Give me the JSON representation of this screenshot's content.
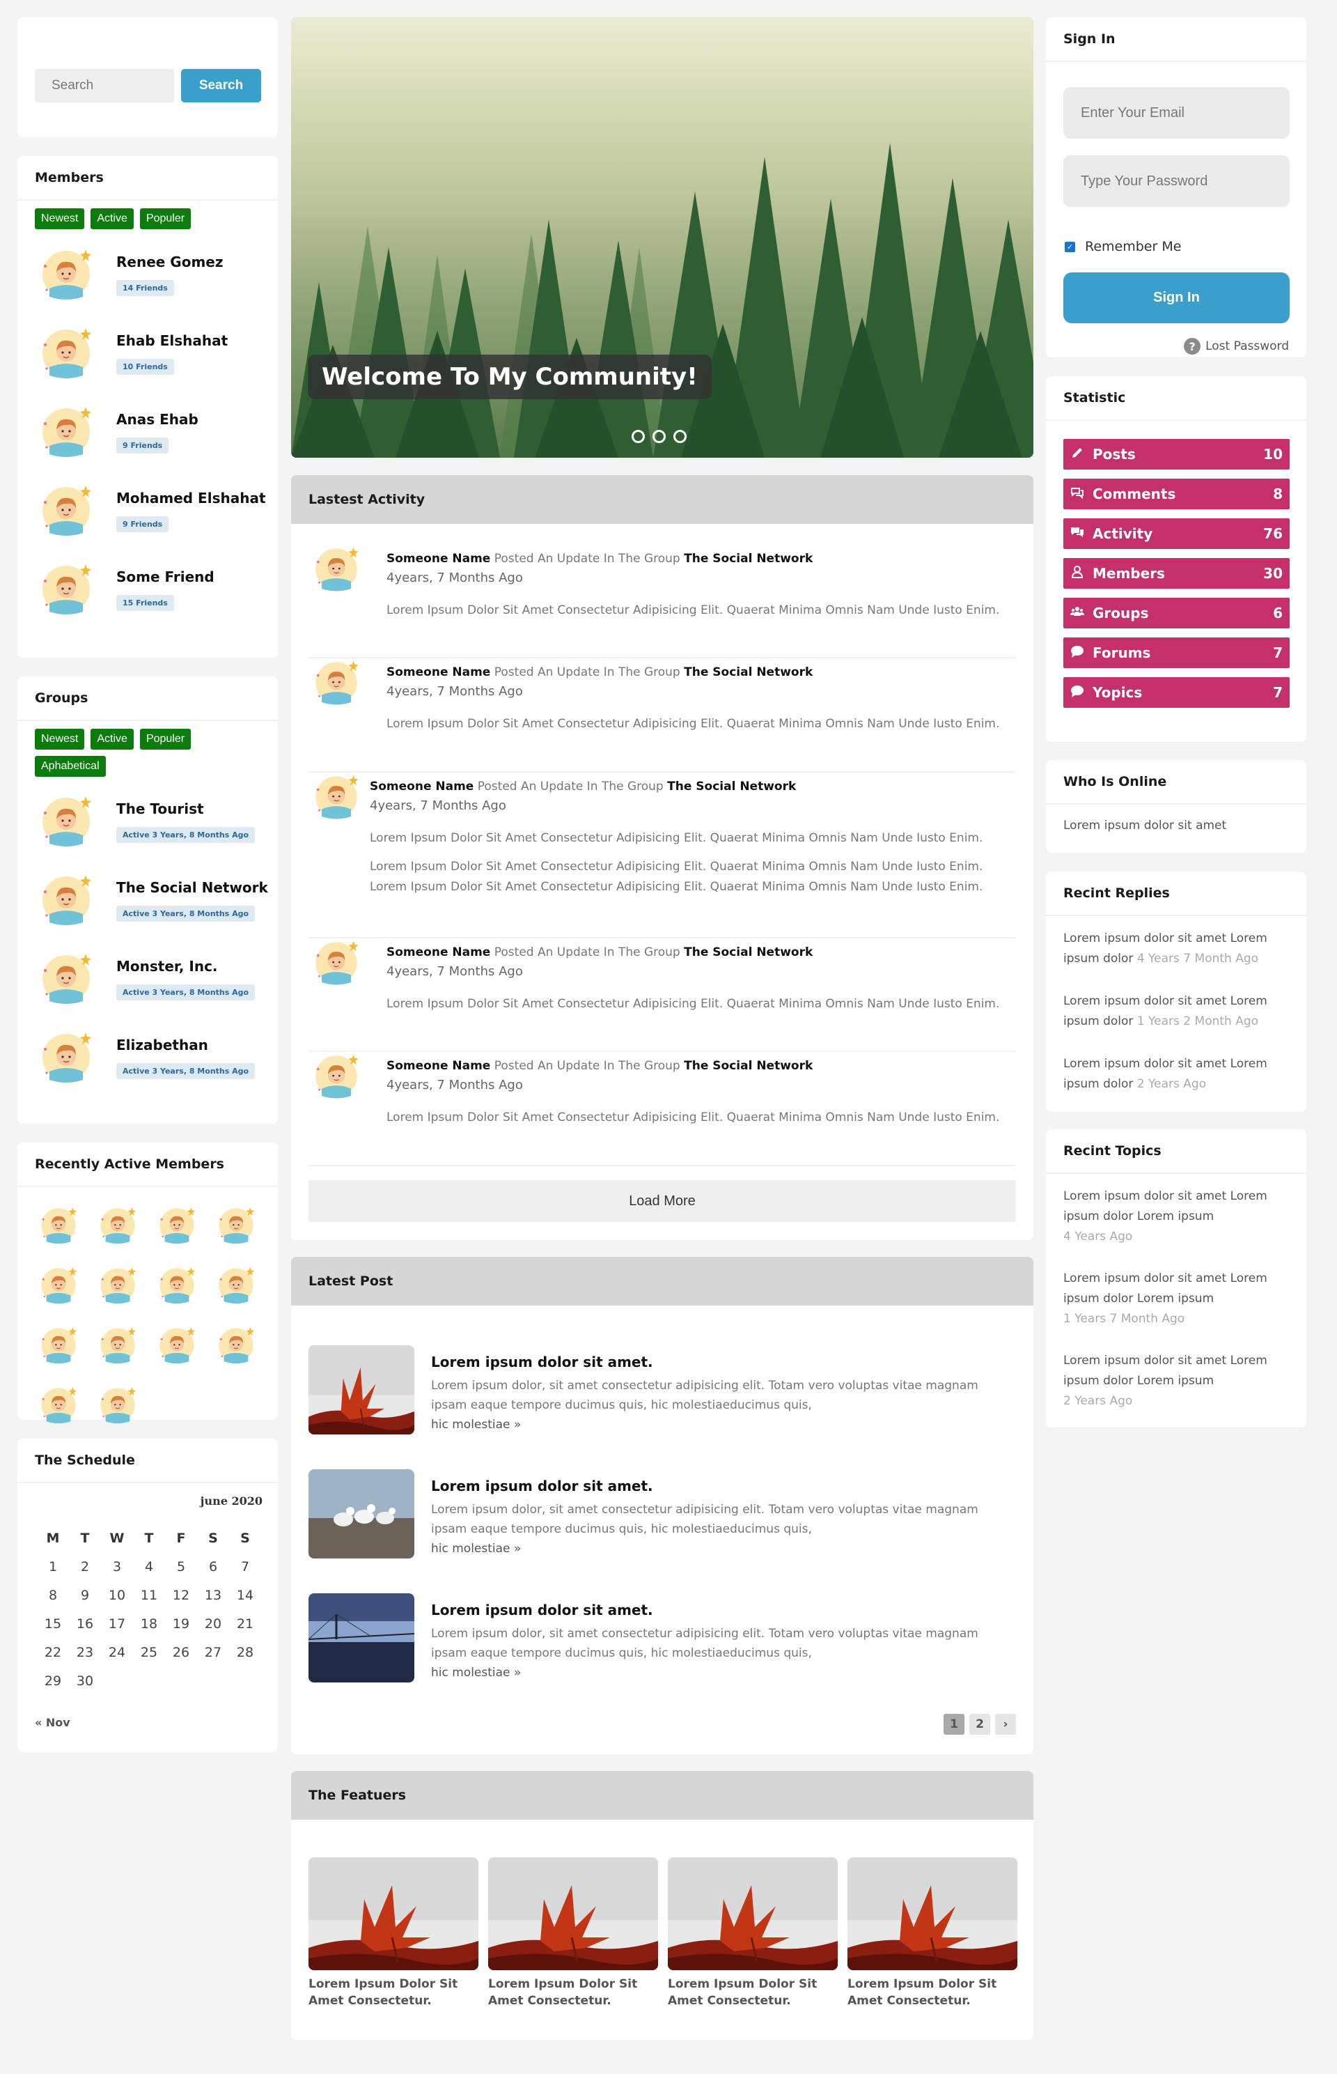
{
  "search": {
    "placeholder": "Search",
    "button": "Search"
  },
  "members": {
    "title": "Members",
    "filters": [
      "Newest",
      "Active",
      "Populer"
    ],
    "list": [
      {
        "name": "Renee Gomez",
        "badge": "14 Friends"
      },
      {
        "name": "Ehab Elshahat",
        "badge": "10 Friends"
      },
      {
        "name": "Anas Ehab",
        "badge": "9 Friends"
      },
      {
        "name": "Mohamed Elshahat",
        "badge": "9 Friends"
      },
      {
        "name": "Some Friend",
        "badge": "15 Friends"
      }
    ]
  },
  "groups": {
    "title": "Groups",
    "filters": [
      "Newest",
      "Active",
      "Populer",
      "Aphabetical"
    ],
    "list": [
      {
        "name": "The Tourist",
        "badge": "Active 3 Years, 8 Months Ago"
      },
      {
        "name": "The Social Network",
        "badge": "Active 3 Years, 8 Months Ago"
      },
      {
        "name": "Monster, Inc.",
        "badge": "Active 3 Years, 8 Months Ago"
      },
      {
        "name": "Elizabethan",
        "badge": "Active 3 Years, 8 Months Ago"
      }
    ]
  },
  "recent_members": {
    "title": "Recently Active Members"
  },
  "schedule": {
    "title": "The Schedule",
    "month": "june 2020",
    "days": [
      "M",
      "T",
      "W",
      "T",
      "F",
      "S",
      "S"
    ],
    "dates": [
      "1",
      "2",
      "3",
      "4",
      "5",
      "6",
      "7",
      "8",
      "9",
      "10",
      "11",
      "12",
      "13",
      "14",
      "15",
      "16",
      "17",
      "18",
      "19",
      "20",
      "21",
      "22",
      "23",
      "24",
      "25",
      "26",
      "27",
      "28",
      "29",
      "30"
    ],
    "prev": "Nov"
  },
  "hero": {
    "caption": "Welcome To My Community!"
  },
  "activity": {
    "title": "Lastest Activity",
    "posted_text": "Posted An Update In The Group",
    "items": [
      {
        "who": "Someone Name",
        "group": "The Social Network",
        "time": "4years, 7 Months Ago",
        "texts": [
          "Lorem Ipsum Dolor Sit Amet Consectetur Adipisicing Elit. Quaerat Minima Omnis Nam Unde Iusto Enim."
        ]
      },
      {
        "who": "Someone Name",
        "group": "The Social Network",
        "time": "4years, 7 Months Ago",
        "texts": [
          "Lorem Ipsum Dolor Sit Amet Consectetur Adipisicing Elit. Quaerat Minima Omnis Nam Unde Iusto Enim."
        ]
      },
      {
        "who": "Someone Name",
        "group": "The Social Network",
        "time": "4years, 7 Months Ago",
        "texts": [
          "Lorem Ipsum Dolor Sit Amet Consectetur Adipisicing Elit. Quaerat Minima Omnis Nam Unde Iusto Enim.",
          "Lorem Ipsum Dolor Sit Amet Consectetur Adipisicing Elit. Quaerat Minima Omnis Nam Unde Iusto Enim. Lorem Ipsum Dolor Sit Amet Consectetur Adipisicing Elit. Quaerat Minima Omnis Nam Unde Iusto Enim."
        ]
      },
      {
        "who": "Someone Name",
        "group": "The Social Network",
        "time": "4years, 7 Months Ago",
        "texts": [
          "Lorem Ipsum Dolor Sit Amet Consectetur Adipisicing Elit. Quaerat Minima Omnis Nam Unde Iusto Enim."
        ]
      },
      {
        "who": "Someone Name",
        "group": "The Social Network",
        "time": "4years, 7 Months Ago",
        "texts": [
          "Lorem Ipsum Dolor Sit Amet Consectetur Adipisicing Elit. Quaerat Minima Omnis Nam Unde Iusto Enim."
        ]
      }
    ],
    "load_more": "Load More"
  },
  "latest_post": {
    "title": "Latest Post",
    "posts": [
      {
        "title": "Lorem ipsum dolor sit amet.",
        "desc": "Lorem ipsum dolor, sit amet consectetur adipisicing elit. Totam vero voluptas vitae magnam ipsam eaque tempore ducimus quis, hic molestiaeducimus quis,",
        "more": "hic molestiae »"
      },
      {
        "title": "Lorem ipsum dolor sit amet.",
        "desc": "Lorem ipsum dolor, sit amet consectetur adipisicing elit. Totam vero voluptas vitae magnam ipsam eaque tempore ducimus quis, hic molestiaeducimus quis,",
        "more": "hic molestiae »"
      },
      {
        "title": "Lorem ipsum dolor sit amet.",
        "desc": "Lorem ipsum dolor, sit amet consectetur adipisicing elit. Totam vero voluptas vitae magnam ipsam eaque tempore ducimus quis, hic molestiaeducimus quis,",
        "more": "hic molestiae »"
      }
    ],
    "pages": [
      "1",
      "2",
      "›"
    ]
  },
  "features": {
    "title": "The Featuers",
    "items": [
      {
        "caption": "Lorem Ipsum Dolor Sit Amet Consectetur."
      },
      {
        "caption": "Lorem Ipsum Dolor Sit Amet Consectetur."
      },
      {
        "caption": "Lorem Ipsum Dolor Sit Amet Consectetur."
      },
      {
        "caption": "Lorem Ipsum Dolor Sit Amet Consectetur."
      }
    ]
  },
  "signin": {
    "title": "Sign In",
    "email_placeholder": "Enter Your Email",
    "password_placeholder": "Type Your Password",
    "remember": "Remember Me",
    "button": "Sign In",
    "lost": "Lost Password"
  },
  "statistic": {
    "title": "Statistic",
    "color": "#c5306a",
    "items": [
      {
        "label": "Posts",
        "value": "10",
        "icon": "pencil-icon"
      },
      {
        "label": "Comments",
        "value": "8",
        "icon": "comments-icon"
      },
      {
        "label": "Activity",
        "value": "76",
        "icon": "chat-icon"
      },
      {
        "label": "Members",
        "value": "30",
        "icon": "user-icon"
      },
      {
        "label": "Groups",
        "value": "6",
        "icon": "users-icon"
      },
      {
        "label": "Forums",
        "value": "7",
        "icon": "comment-icon"
      },
      {
        "label": "Yopics",
        "value": "7",
        "icon": "comment-icon"
      }
    ]
  },
  "online": {
    "title": "Who Is Online",
    "text": "Lorem ipsum dolor sit amet"
  },
  "replies": {
    "title": "Recint Replies",
    "items": [
      {
        "text": "Lorem ipsum dolor sit amet Lorem ipsum dolor",
        "ago": "4 Years 7 Month Ago"
      },
      {
        "text": "Lorem ipsum dolor sit amet Lorem ipsum dolor",
        "ago": "1 Years 2 Month Ago"
      },
      {
        "text": "Lorem ipsum dolor sit amet Lorem ipsum dolor",
        "ago": "2 Years Ago"
      }
    ]
  },
  "topics": {
    "title": "Recint Topics",
    "items": [
      {
        "text": "Lorem ipsum dolor sit amet Lorem ipsum dolor Lorem ipsum",
        "ago": "4 Years Ago"
      },
      {
        "text": "Lorem ipsum dolor sit amet Lorem ipsum dolor Lorem ipsum",
        "ago": "1 Years 7 Month Ago"
      },
      {
        "text": "Lorem ipsum dolor sit amet Lorem ipsum dolor Lorem ipsum",
        "ago": "2 Years Ago"
      }
    ]
  },
  "colors": {
    "accent_blue": "#3a9fcb",
    "tag_green": "#0c7d0c",
    "stat_pink": "#c5306a"
  }
}
